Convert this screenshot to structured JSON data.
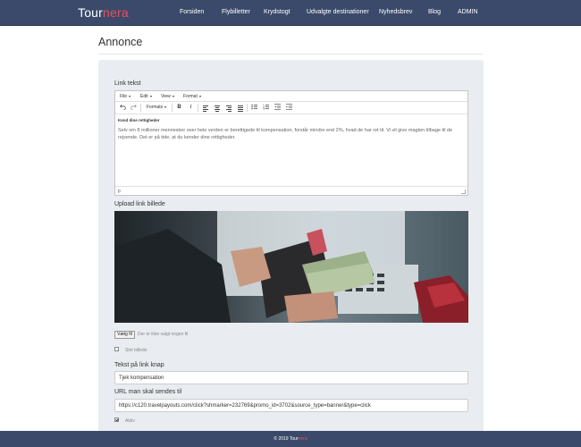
{
  "navbar": {
    "brand_prefix": "Tour",
    "brand_suffix": "nera",
    "links": [
      "Forsiden",
      "Flybilletter",
      "Krydstogt",
      "Udvalgte destinationer",
      "Nyhedsbrev",
      "Blog",
      "ADMIN"
    ]
  },
  "page": {
    "title": "Annonce"
  },
  "form": {
    "link_text_label": "Link tekst",
    "editor": {
      "menus": [
        "File",
        "Edit",
        "View",
        "Format"
      ],
      "formats_label": "Formats",
      "bold_label": "B",
      "italic_label": "I",
      "heading": "Kend dine rettigheder",
      "paragraph": "Selv om 8 millioner mennesker over hele verden er berettigede til kompensation, forstår mindre end 2%, hvad de har ret til. Vi vil give magten tilbage til de rejsende. Det er på tide, at du kender dine rettigheder.",
      "status_path": "p"
    },
    "upload_label": "Upload link billede",
    "choose_file_label": "Vælg fil",
    "no_file_text": "Der er ikke valgt nogen fil",
    "delete_image_label": "Slet billede",
    "delete_image_checked": false,
    "button_text_label": "Tekst på link knap",
    "button_text_value": "Tjek kompensation",
    "url_label": "URL man skal sendes til",
    "url_value": "https://c120.travelpayouts.com/click?shmarker=232769&promo_id=3702&source_type=banner&type=click",
    "active_label": "Aktiv",
    "active_checked": true
  },
  "footer": {
    "prefix": "© 2019 Tour",
    "suffix": "nera"
  },
  "colors": {
    "navbar_bg": "#3b4a6b",
    "brand_accent": "#e8505b",
    "panel_bg": "#e9edf1"
  },
  "icons": [
    "undo-icon",
    "redo-icon",
    "align-left-icon",
    "align-center-icon",
    "align-right-icon",
    "justify-icon",
    "bullet-list-icon",
    "numbered-list-icon",
    "outdent-icon",
    "indent-icon",
    "resize-handle-icon"
  ]
}
